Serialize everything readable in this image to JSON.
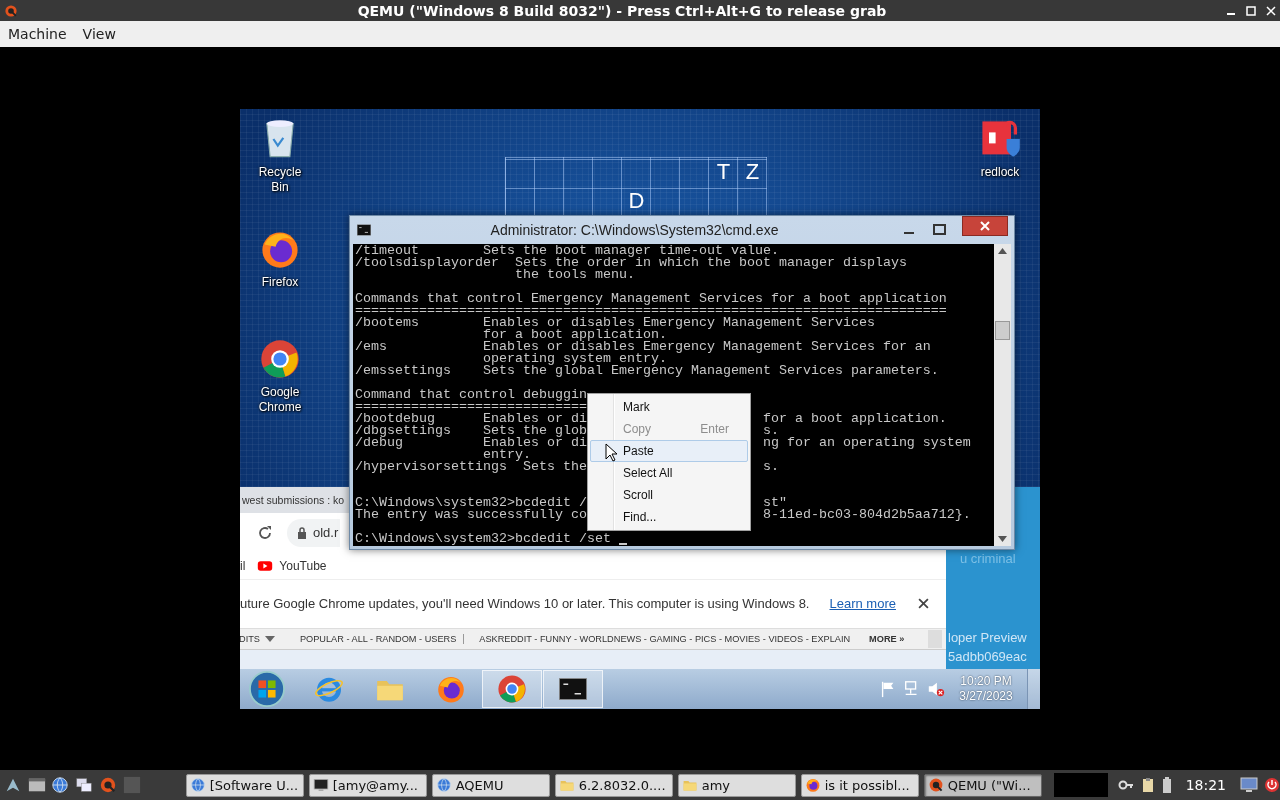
{
  "window": {
    "title": "QEMU (\"Windows 8 Build 8032\") - Press Ctrl+Alt+G to release grab"
  },
  "menu_bar": [
    {
      "label": "Machine"
    },
    {
      "label": "View"
    }
  ],
  "guest": {
    "wallpaper_letters": [
      "T",
      "Z",
      "D"
    ],
    "desktop_icons": [
      {
        "kind": "recycle-bin",
        "label": "Recycle Bin"
      },
      {
        "kind": "firefox",
        "label": "Firefox"
      },
      {
        "kind": "chrome",
        "label": "Google Chrome"
      },
      {
        "kind": "redlock",
        "label": "redlock"
      }
    ],
    "browser": {
      "tab": "west submissions : ko",
      "address": "old.r",
      "bookmarks": [
        {
          "kind": "plain",
          "label": "il"
        },
        {
          "kind": "youtube",
          "label": "YouTube"
        }
      ],
      "infobar": {
        "message": "uture Google Chrome updates, you'll need Windows 10 or later. This computer is using Windows 8.",
        "link": "Learn more"
      },
      "nav": {
        "lead": "DITS",
        "groups": [
          "POPULAR - ALL - RANDOM - USERS",
          "ASKREDDIT - FUNNY - WORLDNEWS - GAMING - PICS - MOVIES - VIDEOS - EXPLAIN"
        ],
        "more": "MORE »"
      }
    },
    "side_panel": [
      "u criminal",
      "loper Preview",
      "5adbb069eac"
    ],
    "console": {
      "title": "Administrator: C:\\Windows\\System32\\cmd.exe",
      "lines": [
        {
          "kind": "text",
          "text": "/timeout        Sets the boot manager time-out value."
        },
        {
          "kind": "text",
          "text": "/toolsdisplayorder  Sets the order in which the boot manager displays"
        },
        {
          "kind": "text",
          "text": "                    the tools menu."
        },
        {
          "kind": "blank"
        },
        {
          "kind": "text",
          "text": "Commands that control Emergency Management Services for a boot application"
        },
        {
          "kind": "text",
          "text": "=========================================================================="
        },
        {
          "kind": "text",
          "text": "/bootems        Enables or disables Emergency Management Services"
        },
        {
          "kind": "text",
          "text": "                for a boot application."
        },
        {
          "kind": "text",
          "text": "/ems            Enables or disables Emergency Management Services for an"
        },
        {
          "kind": "text",
          "text": "                operating system entry."
        },
        {
          "kind": "text",
          "text": "/emssettings    Sets the global Emergency Management Services parameters."
        },
        {
          "kind": "blank"
        },
        {
          "kind": "text",
          "text": "Command that control debuggin"
        },
        {
          "kind": "text",
          "text": "============================="
        },
        {
          "kind": "text",
          "text": "/bootdebug      Enables or di",
          "right": "for a boot application."
        },
        {
          "kind": "text",
          "text": "/dbgsettings    Sets the glob",
          "right": "s."
        },
        {
          "kind": "text",
          "text": "/debug          Enables or di",
          "right": "ng for an operating system"
        },
        {
          "kind": "text",
          "text": "                entry."
        },
        {
          "kind": "text",
          "text": "/hypervisorsettings  Sets the",
          "right": "s."
        },
        {
          "kind": "blank"
        },
        {
          "kind": "blank"
        },
        {
          "kind": "text",
          "text": "C:\\Windows\\system32>bcdedit /",
          "right": "st\""
        },
        {
          "kind": "text",
          "text": "The entry was successfully co",
          "right": "8-11ed-bc03-804d2b5aa712}."
        },
        {
          "kind": "blank"
        },
        {
          "kind": "prompt",
          "text": "C:\\Windows\\system32>bcdedit /set",
          "cursor": true
        }
      ]
    },
    "context_menu": [
      {
        "label": "Mark",
        "disabled": false,
        "selected": false
      },
      {
        "label": "Copy",
        "shortcut": "Enter",
        "disabled": true,
        "selected": false
      },
      {
        "label": "Paste",
        "disabled": false,
        "selected": true
      },
      {
        "label": "Select All",
        "disabled": false,
        "selected": false
      },
      {
        "label": "Scroll",
        "disabled": false,
        "selected": false
      },
      {
        "label": "Find...",
        "disabled": false,
        "selected": false
      }
    ],
    "taskbar": {
      "apps": [
        {
          "kind": "ie",
          "open": false
        },
        {
          "kind": "explorer",
          "open": false
        },
        {
          "kind": "firefox",
          "open": false
        },
        {
          "kind": "chrome",
          "open": true
        },
        {
          "kind": "console",
          "open": true
        }
      ],
      "tray": [
        {
          "kind": "flag"
        },
        {
          "kind": "network"
        },
        {
          "kind": "sound",
          "muted": true
        }
      ],
      "time": "10:20 PM",
      "date": "3/27/2023"
    }
  },
  "host_taskbar": {
    "launchers": [
      {
        "kind": "menu"
      },
      {
        "kind": "desktop"
      },
      {
        "kind": "globe"
      },
      {
        "kind": "windows"
      },
      {
        "kind": "qemu"
      },
      {
        "kind": "blank"
      }
    ],
    "tasks": [
      {
        "kind": "globe",
        "label": "[Software U...",
        "selected": false
      },
      {
        "kind": "terminal",
        "label": "[amy@amy...",
        "selected": false
      },
      {
        "kind": "aqemu",
        "label": "AQEMU",
        "selected": false
      },
      {
        "kind": "folder",
        "label": "6.2.8032.0....",
        "selected": false
      },
      {
        "kind": "folder",
        "label": "amy",
        "selected": false
      },
      {
        "kind": "firefox",
        "label": "is it possibl...",
        "selected": false
      },
      {
        "kind": "qemu",
        "label": "QEMU (\"Wi...",
        "selected": true
      }
    ],
    "clock": "18:21"
  }
}
